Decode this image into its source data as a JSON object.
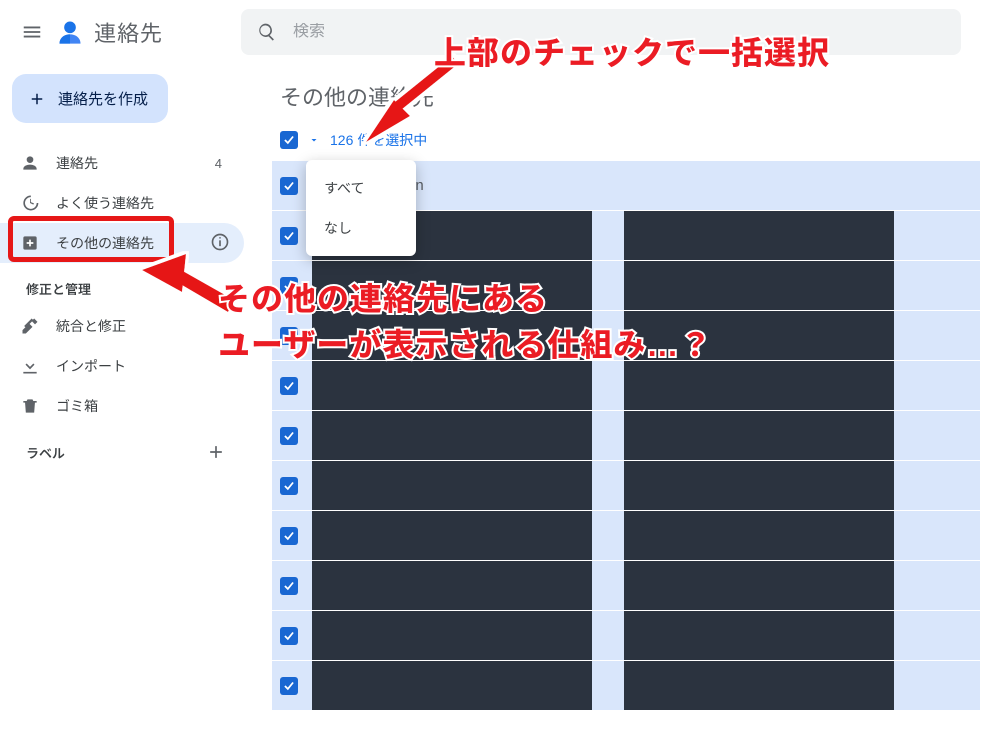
{
  "header": {
    "app_name": "連絡先",
    "search_placeholder": "検索"
  },
  "sidebar": {
    "create_label": "連絡先を作成",
    "items": [
      {
        "icon": "person",
        "label": "連絡先",
        "count": "4"
      },
      {
        "icon": "history",
        "label": "よく使う連絡先"
      },
      {
        "icon": "download-box",
        "label": "その他の連絡先",
        "active": true,
        "info": true
      }
    ],
    "fix_header": "修正と管理",
    "fix_items": [
      {
        "icon": "tools",
        "label": "統合と修正"
      },
      {
        "icon": "download",
        "label": "インポート"
      },
      {
        "icon": "trash",
        "label": "ゴミ箱"
      }
    ],
    "labels_header": "ラベル"
  },
  "main": {
    "title": "その他の連絡先",
    "selection_text": "126 件を選択中",
    "menu": {
      "all": "すべて",
      "none": "なし"
    },
    "sample_email_fragment": "in",
    "row_count": 11
  },
  "annotations": {
    "top": "上部のチェックで一括選択",
    "mid": "その他の連絡先にある\nユーザーが表示される仕組み…？"
  }
}
